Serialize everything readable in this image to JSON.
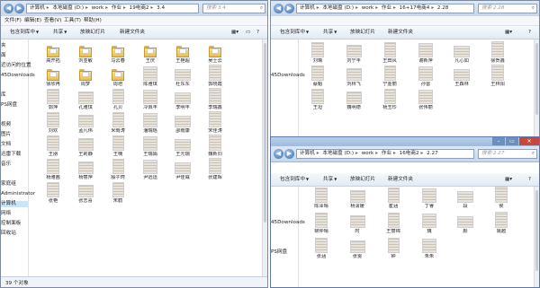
{
  "left": {
    "breadcrumb": [
      "计算机",
      "本地磁盘 (D:)",
      "work",
      "作业",
      "19电商2",
      "3.4"
    ],
    "search_placeholder": "搜索 3.4",
    "toolbar": [
      "包含到库中",
      "共享",
      "放映幻灯片",
      "新建文件夹"
    ],
    "menu": [
      "文件(F)",
      "编辑(E)",
      "查看(V)",
      "工具(T)",
      "帮助(H)"
    ],
    "sidebar": [
      "夹",
      "面",
      "近访问的位置",
      "45Downloads",
      "",
      "库",
      "PS网盘",
      "",
      "视频",
      "图片",
      "文档",
      "迅雷下载",
      "音乐",
      "",
      "家庭组",
      "Administrator",
      "计算机",
      "网络",
      "控制面板",
      "回收站"
    ],
    "files": [
      {
        "name": "高开拓",
        "kind": "folder"
      },
      {
        "name": "刘亚敏",
        "kind": "folder"
      },
      {
        "name": "马云春",
        "kind": "folder"
      },
      {
        "name": "王庆",
        "kind": "folder"
      },
      {
        "name": "王艳超",
        "kind": "folder"
      },
      {
        "name": "吴士云",
        "kind": "folder"
      },
      {
        "name": "徐欣冉",
        "kind": "folder"
      },
      {
        "name": "周梦",
        "kind": "folder"
      },
      {
        "name": "周培",
        "kind": "folder"
      },
      {
        "name": "陈雅琪",
        "kind": "image"
      },
      {
        "name": "杜东东",
        "kind": "image"
      },
      {
        "name": "郭晓霞",
        "kind": "image"
      },
      {
        "name": "郭萍",
        "kind": "image"
      },
      {
        "name": "孔雅琪",
        "kind": "image"
      },
      {
        "name": "孔贝",
        "kind": "image"
      },
      {
        "name": "冷佩丰",
        "kind": "image"
      },
      {
        "name": "李明丰",
        "kind": "image"
      },
      {
        "name": "李瑞鑫",
        "kind": "image"
      },
      {
        "name": "刘欢",
        "kind": "image"
      },
      {
        "name": "孟凡伟",
        "kind": "image"
      },
      {
        "name": "米雨涛",
        "kind": "image"
      },
      {
        "name": "潘瑞瑶",
        "kind": "image"
      },
      {
        "name": "邵雨康",
        "kind": "image"
      },
      {
        "name": "宋佳涛",
        "kind": "image"
      },
      {
        "name": "王朋",
        "kind": "image"
      },
      {
        "name": "王莉静",
        "kind": "image"
      },
      {
        "name": "王楠",
        "kind": "image"
      },
      {
        "name": "王瑞娟",
        "kind": "image"
      },
      {
        "name": "王元瑞",
        "kind": "image"
      },
      {
        "name": "魏新同",
        "kind": "image"
      },
      {
        "name": "杨雅茜",
        "kind": "image"
      },
      {
        "name": "杨丽萍",
        "kind": "image"
      },
      {
        "name": "殷子珂",
        "kind": "image"
      },
      {
        "name": "尹远运",
        "kind": "image"
      },
      {
        "name": "尹佳威",
        "kind": "image"
      },
      {
        "name": "张建晖",
        "kind": "image"
      },
      {
        "name": "张艳",
        "kind": "image"
      },
      {
        "name": "张志喜",
        "kind": "image"
      },
      {
        "name": "朱鹤",
        "kind": "image"
      }
    ],
    "status": "39 个对象"
  },
  "right_top": {
    "breadcrumb": [
      "计算机",
      "本地磁盘 (D:)",
      "work",
      "作业",
      "16+17电商4",
      "2.28"
    ],
    "search_placeholder": "搜索 2.28",
    "toolbar": [
      "包含到库中",
      "共享",
      "放映幻灯片",
      "新建文件夹"
    ],
    "sidebar": [
      "",
      "",
      "",
      "45Downloads"
    ],
    "files": [
      {
        "name": "刘琳",
        "kind": "image"
      },
      {
        "name": "刘宁丰",
        "kind": "image"
      },
      {
        "name": "王田风",
        "kind": "image"
      },
      {
        "name": "谢新萍",
        "kind": "image"
      },
      {
        "name": "凡心如",
        "kind": "image"
      },
      {
        "name": "徐贺鑫",
        "kind": "image"
      },
      {
        "name": "蔡魁",
        "kind": "image"
      },
      {
        "name": "刘林飞",
        "kind": "image"
      },
      {
        "name": "宁金丽",
        "kind": "image"
      },
      {
        "name": "孙雷",
        "kind": "image"
      },
      {
        "name": "王森林",
        "kind": "image"
      },
      {
        "name": "王林阳",
        "kind": "image"
      },
      {
        "name": "王坦",
        "kind": "image"
      },
      {
        "name": "魏明德",
        "kind": "image"
      },
      {
        "name": "杨玉珍",
        "kind": "image"
      },
      {
        "name": "张伟丽",
        "kind": "image"
      }
    ]
  },
  "right_bottom": {
    "breadcrumb": [
      "计算机",
      "本地磁盘 (D:)",
      "work",
      "作业",
      "16电商2",
      "2.27"
    ],
    "search_placeholder": "搜索 2.27",
    "toolbar": [
      "包含到库中",
      "共享",
      "放映幻灯片",
      "新建文件夹"
    ],
    "sidebar": [
      "",
      "",
      "",
      "45Downloads",
      "",
      "",
      "PS网盘"
    ],
    "files": [
      {
        "name": "陈泽晴",
        "kind": "image"
      },
      {
        "name": "杨潇媛",
        "kind": "image"
      },
      {
        "name": "崔涵",
        "kind": "image"
      },
      {
        "name": "丁睿",
        "kind": "image"
      },
      {
        "name": "段",
        "kind": "image"
      },
      {
        "name": "侯",
        "kind": "image"
      },
      {
        "name": "柳仲晴",
        "kind": "image"
      },
      {
        "name": "时",
        "kind": "image"
      },
      {
        "name": "王丽锦",
        "kind": "image"
      },
      {
        "name": "魏",
        "kind": "image"
      },
      {
        "name": "颜",
        "kind": "image"
      },
      {
        "name": "姚越",
        "kind": "image"
      },
      {
        "name": "张涵",
        "kind": "image"
      },
      {
        "name": "张雯",
        "kind": "image"
      },
      {
        "name": "钟",
        "kind": "image"
      },
      {
        "name": "朱朱",
        "kind": "image"
      }
    ]
  }
}
